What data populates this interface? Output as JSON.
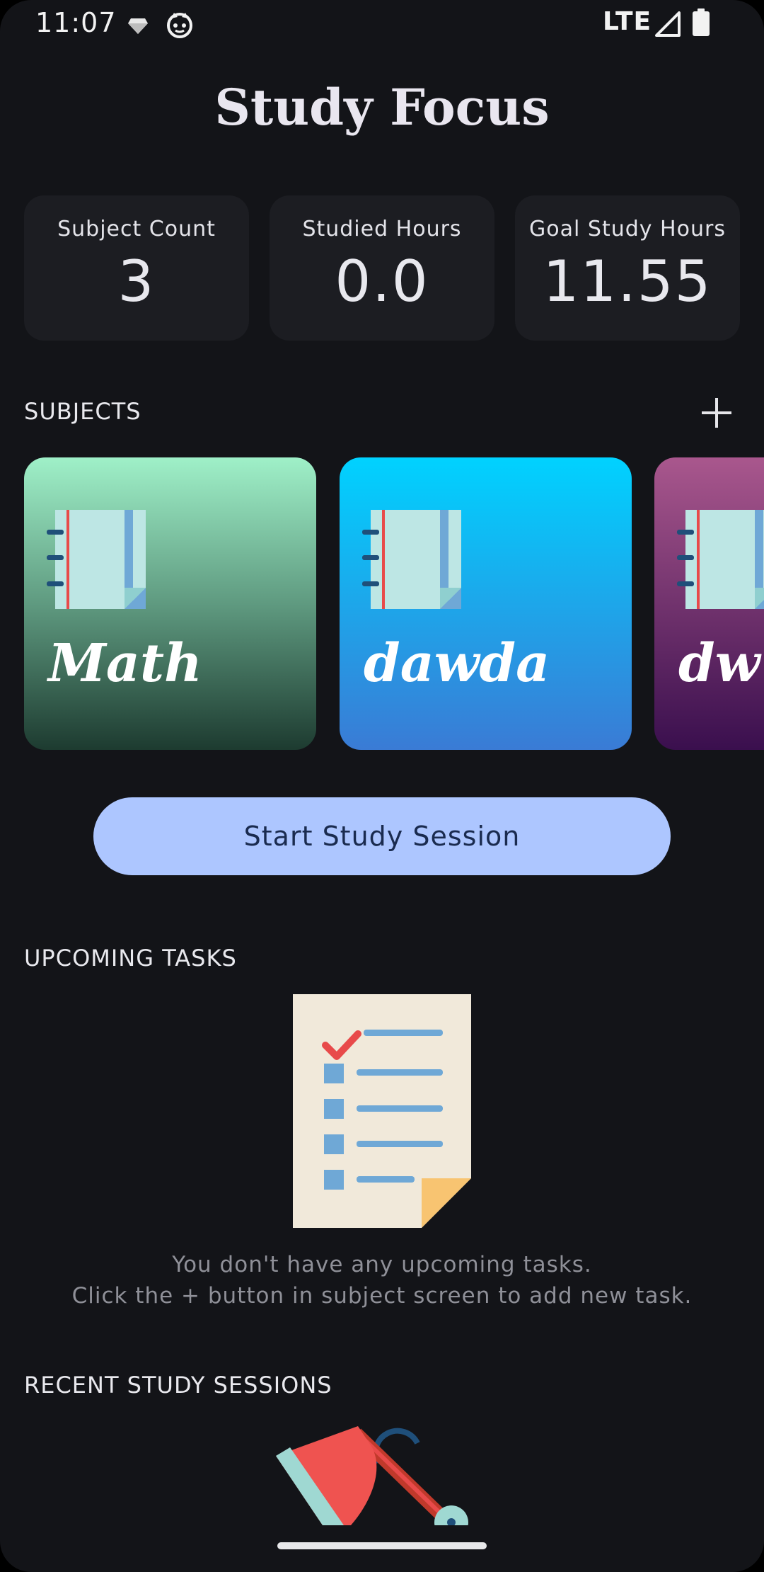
{
  "status_bar": {
    "time": "11:07",
    "network": "LTE",
    "icons": [
      "diamond-notification-icon",
      "cat-notification-icon",
      "signal-icon",
      "battery-icon"
    ]
  },
  "app": {
    "title": "Study Focus"
  },
  "stats": [
    {
      "label": "Subject Count",
      "value": "3"
    },
    {
      "label": "Studied Hours",
      "value": "0.0"
    },
    {
      "label": "Goal Study Hours",
      "value": "11.55"
    }
  ],
  "subjects": {
    "heading": "SUBJECTS",
    "add_icon": "plus-icon",
    "items": [
      {
        "name": "Math",
        "gradient": [
          "#9ff0c8",
          "#1d3b30"
        ]
      },
      {
        "name": "dawda",
        "gradient": [
          "#00d2ff",
          "#3a7bd5"
        ]
      },
      {
        "name": "dw",
        "gradient": [
          "#a9578d",
          "#3a0f4e"
        ]
      }
    ]
  },
  "start_button": {
    "label": "Start Study Session",
    "color": "#adc6ff"
  },
  "upcoming_tasks": {
    "heading": "UPCOMING TASKS",
    "empty_line1": "You don't have any upcoming tasks.",
    "empty_line2": "Click the + button in subject screen to add new task."
  },
  "recent_sessions": {
    "heading": "RECENT STUDY SESSIONS"
  },
  "colors": {
    "background": "#131418",
    "card": "#1c1d22",
    "accent": "#adc6ff"
  }
}
